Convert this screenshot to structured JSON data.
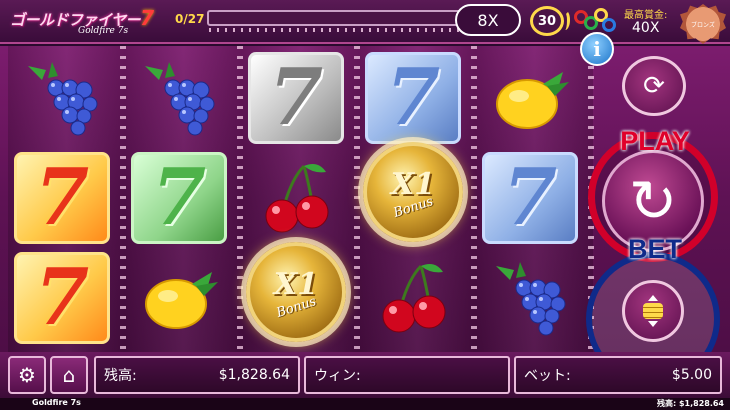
{
  "header": {
    "logo_jp": "ゴールドファイヤー",
    "logo_seven": "7",
    "logo_en": "Goldfire 7s",
    "progress_text": "0/27",
    "progress_fraction": 0.0,
    "multiplier": "8X",
    "spins": "30",
    "top_jackpot_label": "最高賞金:",
    "top_jackpot_value": "40X",
    "badge_text": "ブロンズ"
  },
  "reels": [
    [
      "grapes",
      "seven-fire",
      "seven-fire"
    ],
    [
      "grapes",
      "seven-green",
      "lemon"
    ],
    [
      "seven-gray",
      "cherry",
      "bonus-coin"
    ],
    [
      "seven-blue",
      "bonus-coin",
      "cherry"
    ],
    [
      "lemon",
      "seven-blue",
      "grapes"
    ]
  ],
  "symbols": {
    "seven": "7",
    "bonus_multiplier": "X1",
    "bonus_text": "Bonus",
    "grapes_glyph": "🍇",
    "lemon_glyph": "🍋",
    "cherry_glyph": "🍒"
  },
  "controls": {
    "info_label": "i",
    "autoplay_glyph": "⟳",
    "play_label": "PLAY",
    "play_glyph": "↻",
    "bet_label": "BET"
  },
  "bottom": {
    "settings_glyph": "⚙",
    "home_glyph": "⌂",
    "balance_label": "残高:",
    "balance_value": "$1,828.64",
    "win_label": "ウィン:",
    "win_value": "",
    "bet_field_label": "ベット:",
    "bet_value": "$5.00"
  },
  "footer": {
    "game_name": "Goldfire 7s",
    "balance_text": "残高: $1,828.64"
  }
}
